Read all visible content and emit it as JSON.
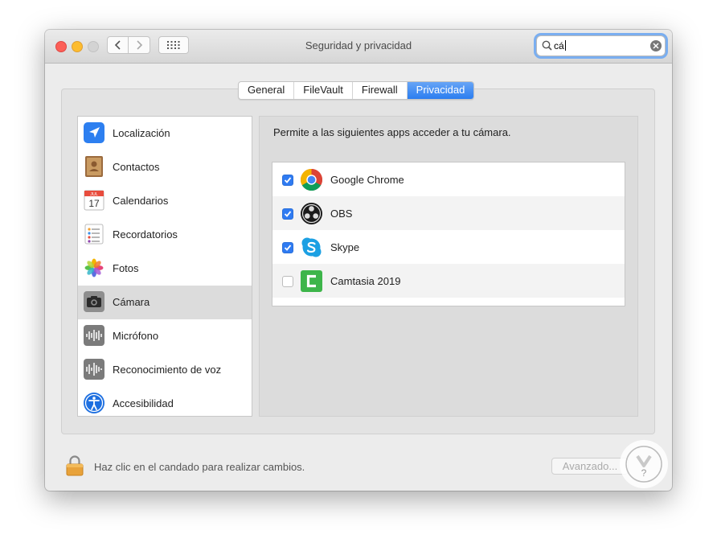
{
  "window": {
    "title": "Seguridad y privacidad"
  },
  "search": {
    "value": "cá"
  },
  "tabs": [
    {
      "label": "General",
      "active": false
    },
    {
      "label": "FileVault",
      "active": false
    },
    {
      "label": "Firewall",
      "active": false
    },
    {
      "label": "Privacidad",
      "active": true
    }
  ],
  "sidebar": {
    "selected": "Cámara",
    "items": [
      {
        "label": "Localización",
        "icon": "location-icon"
      },
      {
        "label": "Contactos",
        "icon": "contacts-icon"
      },
      {
        "label": "Calendarios",
        "icon": "calendar-icon",
        "icon_text": "17",
        "icon_month": "JUL"
      },
      {
        "label": "Recordatorios",
        "icon": "reminders-icon"
      },
      {
        "label": "Fotos",
        "icon": "photos-icon"
      },
      {
        "label": "Cámara",
        "icon": "camera-icon"
      },
      {
        "label": "Micrófono",
        "icon": "microphone-icon"
      },
      {
        "label": "Reconocimiento de voz",
        "icon": "speech-recognition-icon"
      },
      {
        "label": "Accesibilidad",
        "icon": "accessibility-icon"
      }
    ]
  },
  "content": {
    "description": "Permite a las siguientes apps acceder a tu cámara.",
    "apps": [
      {
        "name": "Google Chrome",
        "checked": true,
        "icon": "chrome-icon"
      },
      {
        "name": "OBS",
        "checked": true,
        "icon": "obs-icon"
      },
      {
        "name": "Skype",
        "checked": true,
        "icon": "skype-icon"
      },
      {
        "name": "Camtasia 2019",
        "checked": false,
        "icon": "camtasia-icon"
      }
    ]
  },
  "footer": {
    "lock_text": "Haz clic en el candado para realizar cambios.",
    "advanced_label": "Avanzado..."
  },
  "colors": {
    "accent": "#2f7bf2",
    "checkbox_on": "#2f7bf2"
  }
}
